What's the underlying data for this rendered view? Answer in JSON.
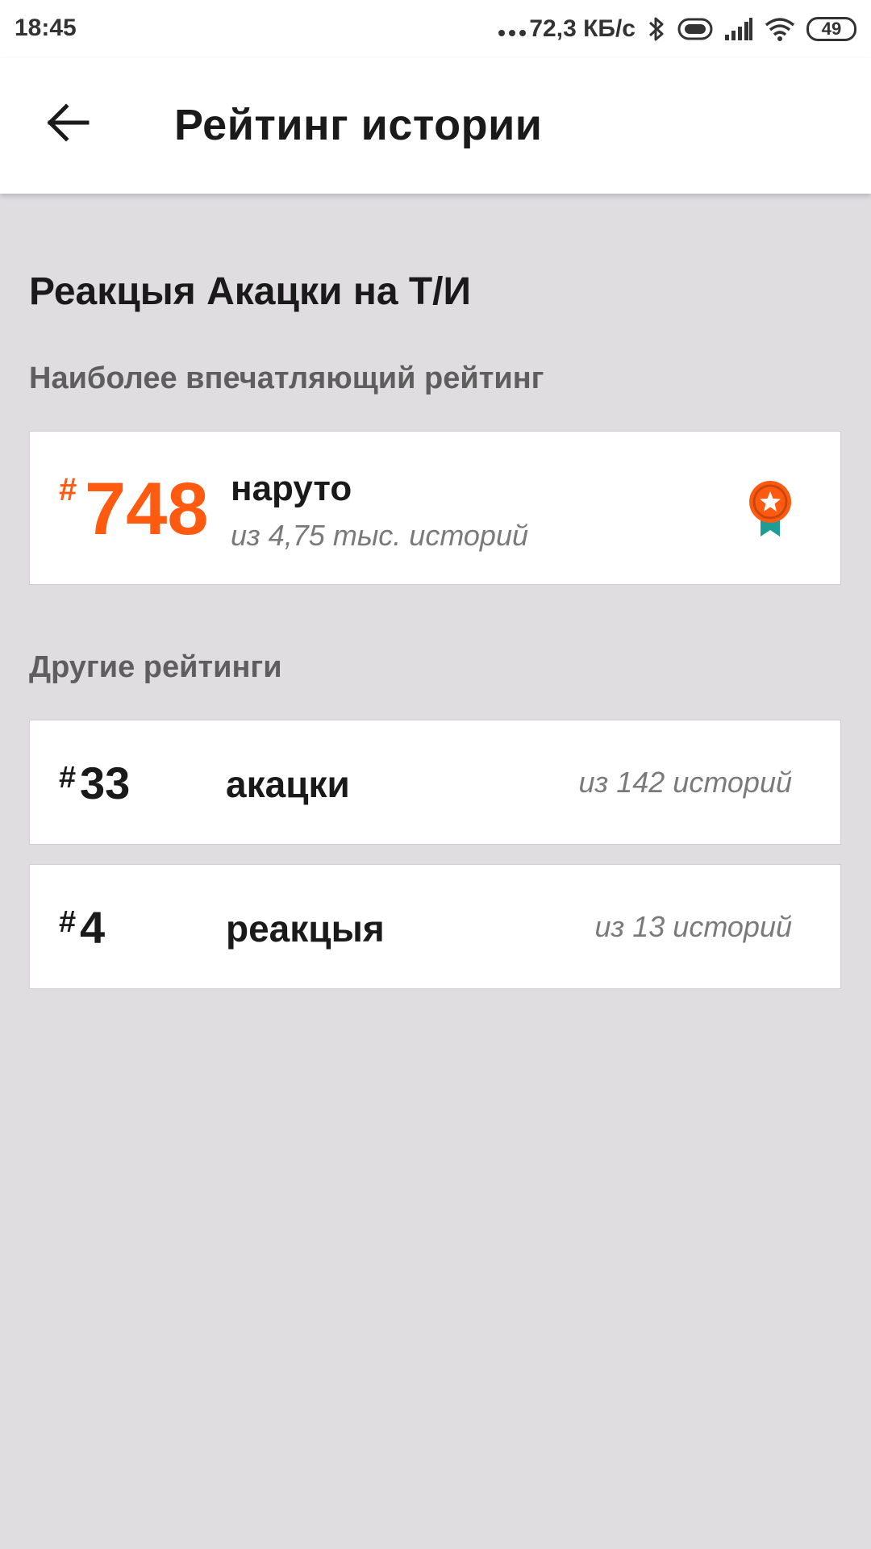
{
  "status_bar": {
    "time": "18:45",
    "network_speed": "72,3 КБ/с",
    "battery": "49"
  },
  "toolbar": {
    "title": "Рейтинг истории"
  },
  "story": {
    "title": "Реакцыя Акацки на Т/И"
  },
  "best_ranking": {
    "section_label": "Наиболее впечатляющий рейтинг",
    "hash": "#",
    "rank": "748",
    "tag": "наруто",
    "subtitle": "из 4,75 тыс. историй",
    "accent_color": "#ff5b10",
    "ribbon_color": "#1e9c96"
  },
  "other_rankings": {
    "section_label": "Другие рейтинги",
    "items": [
      {
        "hash": "#",
        "rank": "33",
        "tag": "акацки",
        "subtitle": "из 142 историй"
      },
      {
        "hash": "#",
        "rank": "4",
        "tag": "реакцыя",
        "subtitle": "из 13 историй"
      }
    ]
  },
  "icons": {
    "back": "arrow-left-icon",
    "award": "award-ribbon-icon",
    "bluetooth": "bluetooth-icon",
    "vibrate": "vibrate-icon",
    "signal": "signal-icon",
    "wifi": "wifi-icon",
    "battery": "battery-icon"
  }
}
